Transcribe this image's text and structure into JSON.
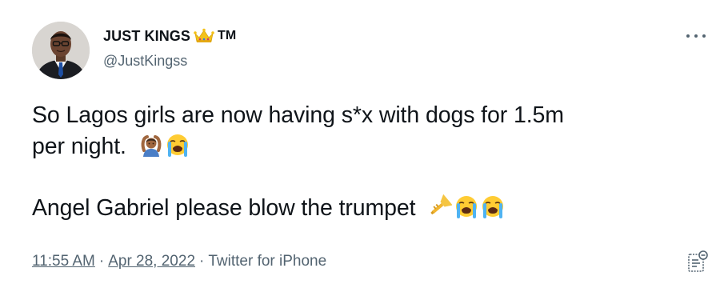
{
  "tweet": {
    "author": {
      "display_name": "JUST KINGS",
      "name_emoji": "crown-icon",
      "name_suffix": "TM",
      "handle": "@JustKingss",
      "avatar": "avatar-man-in-suit"
    },
    "more_icon": "more-horizontal-icon",
    "text": {
      "line1": "So Lagos girls are now having s*x with dogs for 1.5m",
      "line2": "per night.",
      "line2_emojis": [
        "person-gesturing-ok-icon",
        "loudly-crying-face-icon"
      ],
      "line3": "Angel Gabriel please blow the trumpet",
      "line3_emojis": [
        "trumpet-icon",
        "loudly-crying-face-icon",
        "loudly-crying-face-icon"
      ]
    },
    "meta": {
      "time": "11:55 AM",
      "dot1": "·",
      "date": "Apr 28, 2022",
      "dot2": "·",
      "source": "Twitter for iPhone"
    },
    "analytics_icon": "analytics-icon"
  },
  "colors": {
    "text": "#0f1419",
    "secondary": "#536471",
    "background": "#ffffff",
    "crown": "#f4c21a"
  }
}
